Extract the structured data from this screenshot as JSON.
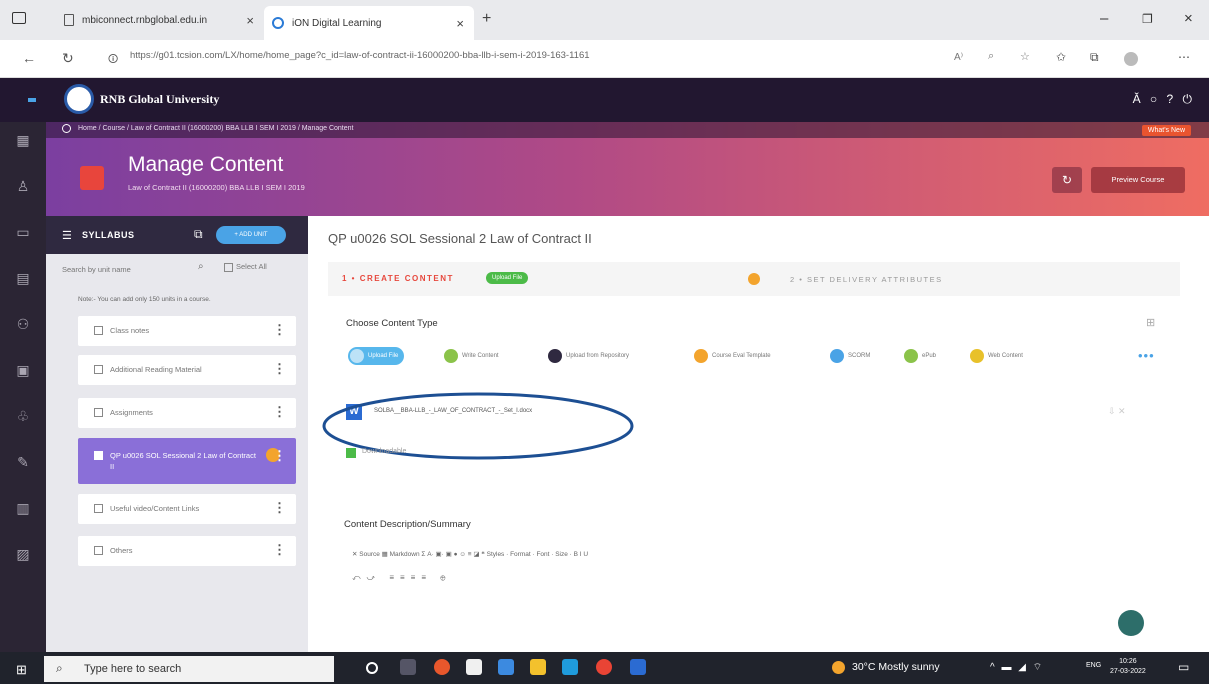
{
  "browser": {
    "tabs": [
      {
        "title": "mbiconnect.rnbglobal.edu.in",
        "close": "×"
      },
      {
        "title": "iON Digital Learning",
        "close": "×"
      }
    ],
    "new_tab": "+",
    "window_controls": [
      "–",
      "❐",
      "×"
    ],
    "url": "https://g01.tcsion.com/LX/home/home_page?c_id=law-of-contract-ii-16000200-bba-llb-i-sem-i-2019-163-1161"
  },
  "app": {
    "university_name": "RNB Global University",
    "header_right": "Ă ○ ? ⏻"
  },
  "hero": {
    "breadcrumb": "Home  /  Course  /  Law of Contract II (16000200) BBA LLB I SEM I 2019  /  Manage Content",
    "whats_new": "What's New",
    "title": "Manage Content",
    "subtitle": "Law of Contract II (16000200) BBA LLB I SEM I 2019",
    "preview_label": "Preview Course"
  },
  "syllabus": {
    "title": "SYLLABUS",
    "add_button": "+ ADD UNIT",
    "search_placeholder": "Search by unit name",
    "select_all": "Select All",
    "note": "Note:- You can add only 150 units in a course.",
    "units": [
      {
        "label": "Class notes"
      },
      {
        "label": "Additional Reading Material"
      },
      {
        "label": "Assignments"
      },
      {
        "label": "QP u0026 SOL Sessional 2 Law of Contract II"
      },
      {
        "label": "Useful video/Content Links"
      },
      {
        "label": "Others"
      }
    ]
  },
  "main": {
    "title": "QP u0026 SOL Sessional 2 Law of Contract II",
    "step1": "1 • CREATE CONTENT",
    "step1_badge": "Upload File",
    "step2": "2 • SET DELIVERY ATTRIBUTES",
    "choose_title": "Choose Content Type",
    "content_types": [
      {
        "label": "Upload File",
        "color": "#57b7ec"
      },
      {
        "label": "Write Content",
        "color": "#8bc34a"
      },
      {
        "label": "Upload from Repository",
        "color": "#2f2940"
      },
      {
        "label": "Course Eval Template",
        "color": "#f3a42d"
      },
      {
        "label": "SCORM",
        "color": "#4aa3e6"
      },
      {
        "label": "ePub",
        "color": "#8bc34a"
      },
      {
        "label": "Web Content",
        "color": "#e8c12a"
      }
    ],
    "more": "•••",
    "file_icon": "W",
    "file_name": "SOLBA__BBA-LLB_-_LAW_OF_CONTRACT_-_Set_I.docx",
    "downloadable_label": "Downloadable",
    "desc_title": "Content Description/Summary",
    "toolbar_row1": "✕ Source   ▦ Markdown   Σ         A·  ▣·   ▣  ●  ☺  ≡  ◪  ❝    Styles   ·   Format   ·   Font   ·   Size   ·   B  I  U",
    "toolbar_row2": "⤺⤻ ≡≡≡≡ ⊕"
  },
  "taskbar": {
    "search_placeholder": "Type here to search",
    "weather": "30°C  Mostly sunny",
    "lang": "ENG",
    "time": "10:26",
    "date": "27-03-2022"
  }
}
